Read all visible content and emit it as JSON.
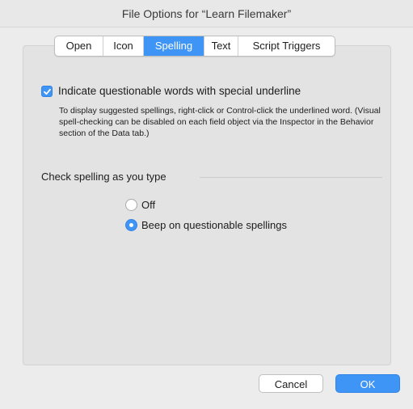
{
  "window": {
    "title": "File Options for “Learn Filemaker”"
  },
  "tabs": [
    {
      "label": "Open",
      "active": false
    },
    {
      "label": "Icon",
      "active": false
    },
    {
      "label": "Spelling",
      "active": true
    },
    {
      "label": "Text",
      "active": false
    },
    {
      "label": "Script Triggers",
      "active": false
    }
  ],
  "spelling": {
    "underline_checkbox": {
      "label": "Indicate questionable words with special underline",
      "checked": true
    },
    "help_text": "To display suggested spellings, right-click or Control-click the underlined word. (Visual spell-checking can be disabled on each field object via the Inspector in the Behavior section of the Data tab.)",
    "section_label": "Check spelling as you type",
    "options": [
      {
        "label": "Off",
        "selected": false
      },
      {
        "label": "Beep on questionable spellings",
        "selected": true
      }
    ]
  },
  "buttons": {
    "cancel_label": "Cancel",
    "ok_label": "OK"
  },
  "colors": {
    "accent": "#3f95f6",
    "window_bg": "#ececec",
    "panel_bg": "#e3e3e3"
  }
}
